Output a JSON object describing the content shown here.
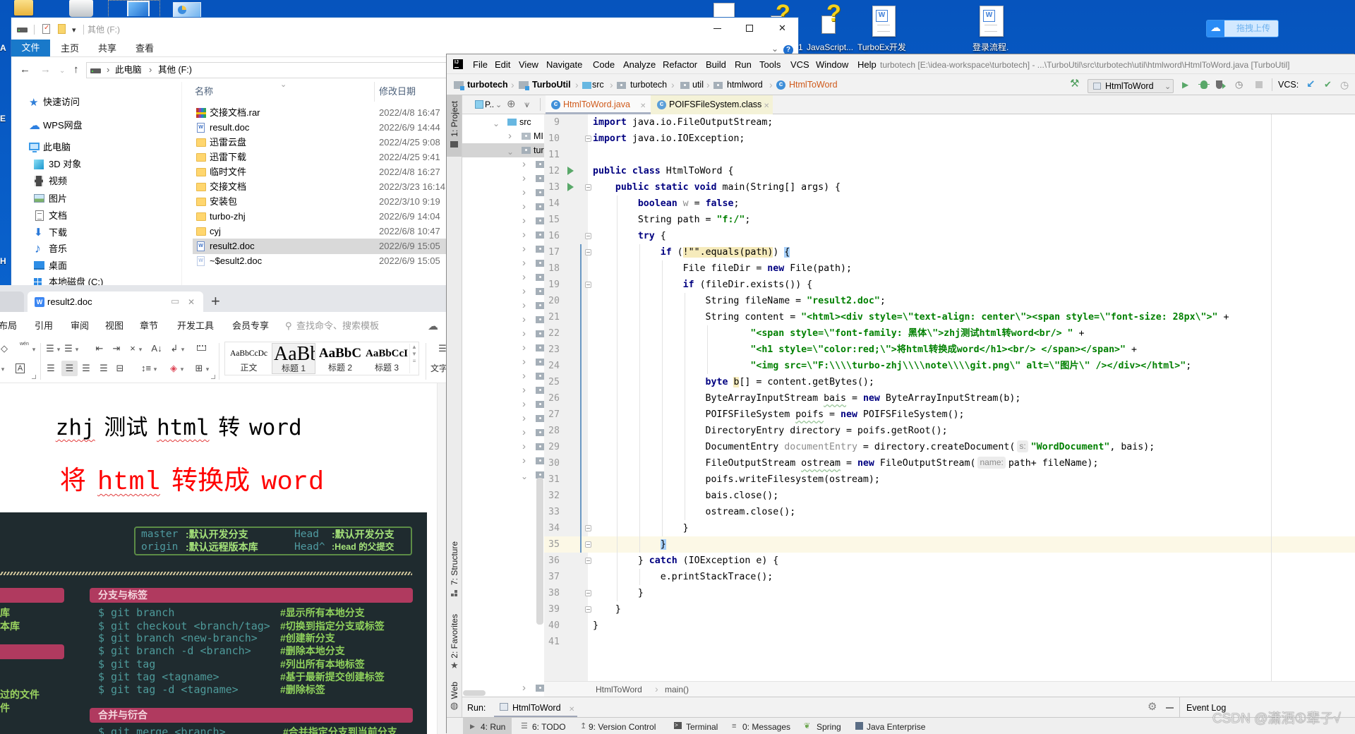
{
  "desktop": {
    "edge_letters": [
      "A",
      "E",
      "H"
    ],
    "icons": [
      {
        "label": "1",
        "icon": "help-file"
      },
      {
        "label": "JavaScript...",
        "icon": "help-file"
      },
      {
        "label": "TurboEx开发",
        "icon": "word-document"
      },
      {
        "label": "登录流程.",
        "icon": "word-document"
      }
    ],
    "upload_widget": {
      "label": "拖拽上传",
      "icon": "baidu-netdisk",
      "color": "#2b8cf5"
    }
  },
  "explorer": {
    "title": "其他 (F:)",
    "ribbon_tabs": [
      "文件",
      "主页",
      "共享",
      "查看"
    ],
    "active_ribbon_tab": "文件",
    "accent": "#1979ca",
    "address": [
      "此电脑",
      "其他 (F:)"
    ],
    "nav": [
      {
        "label": "快速访问",
        "icon": "star"
      },
      {
        "label": "WPS网盘",
        "icon": "cloud"
      },
      {
        "label": "此电脑",
        "icon": "computer"
      },
      {
        "label": "3D 对象",
        "icon": "cube"
      },
      {
        "label": "视频",
        "icon": "video"
      },
      {
        "label": "图片",
        "icon": "picture"
      },
      {
        "label": "文档",
        "icon": "document"
      },
      {
        "label": "下载",
        "icon": "download"
      },
      {
        "label": "音乐",
        "icon": "music"
      },
      {
        "label": "桌面",
        "icon": "desktop"
      },
      {
        "label": "本地磁盘 (C:)",
        "icon": "drive"
      }
    ],
    "columns": {
      "name": "名称",
      "modified": "修改日期"
    },
    "files": [
      {
        "name": "交接文档.rar",
        "modified": "2022/4/8 16:47",
        "type": "rar"
      },
      {
        "name": "result.doc",
        "modified": "2022/6/9 14:44",
        "type": "doc"
      },
      {
        "name": "迅雷云盘",
        "modified": "2022/4/25 9:08",
        "type": "folder"
      },
      {
        "name": "迅雷下载",
        "modified": "2022/4/25 9:41",
        "type": "folder"
      },
      {
        "name": "临时文件",
        "modified": "2022/4/8 16:27",
        "type": "folder"
      },
      {
        "name": "交接文档",
        "modified": "2022/3/23 16:14",
        "type": "folder"
      },
      {
        "name": "安装包",
        "modified": "2022/3/10 9:19",
        "type": "folder"
      },
      {
        "name": "turbo-zhj",
        "modified": "2022/6/9 14:04",
        "type": "folder"
      },
      {
        "name": "cyj",
        "modified": "2022/6/8 10:47",
        "type": "folder"
      },
      {
        "name": "result2.doc",
        "modified": "2022/6/9 15:05",
        "type": "doc",
        "selected": true
      },
      {
        "name": "~$esult2.doc",
        "modified": "2022/6/9 15:05",
        "type": "doc-temp"
      }
    ]
  },
  "wps": {
    "tab": "result2.doc",
    "menu": [
      "布局",
      "引用",
      "审阅",
      "视图",
      "章节",
      "开发工具",
      "会员专享"
    ],
    "search_placeholder": "查找命令、搜索模板",
    "pinyin_hint": "wén",
    "styles": [
      {
        "sample": "AaBbCcDc",
        "label": "正文"
      },
      {
        "sample": "AaBb",
        "label": "标题 1",
        "selected": true
      },
      {
        "sample": "AaBbC",
        "label": "标题 2"
      },
      {
        "sample": "AaBbCcI",
        "label": "标题 3"
      }
    ],
    "text_tool_label": "文字",
    "document": {
      "line1": [
        {
          "text": "zhj",
          "misspelled": true
        },
        {
          "text": " 测试 "
        },
        {
          "text": "html",
          "misspelled": true
        },
        {
          "text": " 转 word"
        }
      ],
      "line2": [
        {
          "text": "将 "
        },
        {
          "text": "html",
          "misspelled": true
        },
        {
          "text": " 转换成 word"
        }
      ],
      "line2_color": "#ff0000",
      "image": {
        "legend": [
          {
            "term": "master",
            "desc": ":默认开发分支"
          },
          {
            "term": "Head",
            "desc": ":默认开发分支"
          },
          {
            "term": "origin",
            "desc": ":默认远程版本库"
          },
          {
            "term": "Head^",
            "desc": ":Head 的父提交"
          }
        ],
        "left_fragments": [
          "库",
          "本库",
          "过的文件",
          "件"
        ],
        "sections": [
          {
            "title": "分支与标签",
            "commands": [
              {
                "cmd": "$ git branch",
                "comment": "#显示所有本地分支"
              },
              {
                "cmd": "$ git checkout <branch/tag>",
                "comment": "#切换到指定分支或标签"
              },
              {
                "cmd": "$ git branch <new-branch>",
                "comment": "#创建新分支"
              },
              {
                "cmd": "$ git branch -d <branch>",
                "comment": "#删除本地分支"
              },
              {
                "cmd": "$ git tag",
                "comment": "#列出所有本地标签"
              },
              {
                "cmd": "$ git tag <tagname>",
                "comment": "#基于最新提交创建标签"
              },
              {
                "cmd": "$ git tag -d <tagname>",
                "comment": "#删除标签"
              }
            ]
          },
          {
            "title": "合并与衍合",
            "commands": [
              {
                "cmd": "$ git merge <branch>",
                "comment": "#合并指定分支到当前分支"
              }
            ]
          }
        ],
        "colors": {
          "background": "#1f2b2f",
          "section_bar": "#b03a5f",
          "command": "#4e9a9a",
          "comment": "#8fd15c",
          "legend_border": "#5c8c46"
        }
      }
    }
  },
  "ide": {
    "menu": [
      "File",
      "Edit",
      "View",
      "Navigate",
      "Code",
      "Analyze",
      "Refactor",
      "Build",
      "Run",
      "Tools",
      "VCS",
      "Window",
      "Help"
    ],
    "title": "turbotech [E:\\idea-workspace\\turbotech] - ...\\TurboUtil\\src\\turbotech\\util\\htmlword\\HtmlToWord.java [TurboUtil]",
    "navbar": [
      "turbotech",
      "TurboUtil",
      "src",
      "turbotech",
      "util",
      "htmlword",
      "HtmlToWord"
    ],
    "run_config": "HtmlToWord",
    "vcs_label": "VCS:",
    "tool_stripe": [
      "1: Project",
      "7: Structure",
      "2: Favorites",
      "Web"
    ],
    "project": {
      "view_label": "P..",
      "tree": [
        {
          "label": "src",
          "expanded": true
        },
        {
          "label": "MI",
          "expanded": false
        },
        {
          "label": "tur",
          "expanded": true,
          "selected": true
        }
      ],
      "collapsed_child_rows": 22
    },
    "tabs": [
      {
        "label": "HtmlToWord.java",
        "active": true
      },
      {
        "label": "POIFSFileSystem.class",
        "active": false
      }
    ],
    "editor": {
      "first_line": 9,
      "current_line": 35,
      "run_lines": [
        12,
        13
      ],
      "fold_lines": [
        10,
        13,
        16,
        17,
        19,
        34,
        35,
        36,
        38,
        39
      ],
      "changed_lines": [
        17,
        35
      ],
      "lines": [
        [
          [
            "kw",
            "import"
          ],
          [
            "",
            " java.io.FileOutputStream;"
          ]
        ],
        [
          [
            "kw",
            "import"
          ],
          [
            "",
            " java.io.IOException;"
          ]
        ],
        [],
        [
          [
            "kw",
            "public class"
          ],
          [
            "",
            " HtmlToWord {"
          ]
        ],
        [
          [
            "",
            "    "
          ],
          [
            "kw",
            "public static void"
          ],
          [
            "",
            " main(String[] args) {"
          ]
        ],
        [
          [
            "",
            "        "
          ],
          [
            "kw",
            "boolean"
          ],
          [
            "",
            " "
          ],
          [
            "unused",
            "w"
          ],
          [
            "",
            " = "
          ],
          [
            "kw",
            "false"
          ],
          [
            "",
            ";"
          ]
        ],
        [
          [
            "",
            "        String path = "
          ],
          [
            "str",
            "\"f:/\""
          ],
          [
            "",
            ";"
          ]
        ],
        [
          [
            "",
            "        "
          ],
          [
            "kw",
            "try"
          ],
          [
            "",
            " {"
          ]
        ],
        [
          [
            "",
            "            "
          ],
          [
            "kw",
            "if"
          ],
          [
            "",
            " ("
          ],
          [
            "hl",
            "!\"\".equals(path)"
          ],
          [
            "",
            ") "
          ],
          [
            "brace",
            "{"
          ]
        ],
        [
          [
            "",
            "                File fileDir = "
          ],
          [
            "kw",
            "new"
          ],
          [
            "",
            " File(path);"
          ]
        ],
        [
          [
            "",
            "                "
          ],
          [
            "kw",
            "if"
          ],
          [
            "",
            " (fileDir.exists()) {"
          ]
        ],
        [
          [
            "",
            "                    String fileName = "
          ],
          [
            "str",
            "\"result2.doc\""
          ],
          [
            "",
            ";"
          ]
        ],
        [
          [
            "",
            "                    String content = "
          ],
          [
            "str",
            "\"<html><div style=\\\"text-align: center\\\"><span style=\\\"font-size: 28px\\\">\""
          ],
          [
            "",
            " +"
          ]
        ],
        [
          [
            "",
            "                            "
          ],
          [
            "str",
            "\"<span style=\\\"font-family: 黑体\\\">zhj测试html转word<br/> \""
          ],
          [
            "",
            " +"
          ]
        ],
        [
          [
            "",
            "                            "
          ],
          [
            "str",
            "\"<h1 style=\\\"color:red;\\\">将html转换成word</h1><br/> </span></span>\""
          ],
          [
            "",
            " +"
          ]
        ],
        [
          [
            "",
            "                            "
          ],
          [
            "str",
            "\"<img src=\\\"F:\\\\\\\\turbo-zhj\\\\\\\\note\\\\\\\\git.png\\\" alt=\\\"图片\\\" /></div></html>\""
          ],
          [
            "",
            ";"
          ]
        ],
        [
          [
            "",
            "                    "
          ],
          [
            "kw",
            "byte"
          ],
          [
            "",
            " "
          ],
          [
            "hlvar",
            "b"
          ],
          [
            "",
            "[] = content.getBytes();"
          ]
        ],
        [
          [
            "",
            "                    ByteArrayInputStream "
          ],
          [
            "wavy",
            "bais"
          ],
          [
            "",
            " = "
          ],
          [
            "kw",
            "new"
          ],
          [
            "",
            " ByteArrayInputStream(b);"
          ]
        ],
        [
          [
            "",
            "                    POIFSFileSystem "
          ],
          [
            "wavy",
            "poifs"
          ],
          [
            "",
            " = "
          ],
          [
            "kw",
            "new"
          ],
          [
            "",
            " POIFSFileSystem();"
          ]
        ],
        [
          [
            "",
            "                    DirectoryEntry directory = poifs.getRoot();"
          ]
        ],
        [
          [
            "",
            "                    DocumentEntry "
          ],
          [
            "unused",
            "documentEntry"
          ],
          [
            "",
            " = directory.createDocument("
          ],
          [
            "hint",
            "s:"
          ],
          [
            "str",
            "\"WordDocument\""
          ],
          [
            "",
            ", bais);"
          ]
        ],
        [
          [
            "",
            "                    FileOutputStream "
          ],
          [
            "wavy",
            "ostream"
          ],
          [
            "",
            " = "
          ],
          [
            "kw",
            "new"
          ],
          [
            "",
            " FileOutputStream("
          ],
          [
            "hint",
            "name:"
          ],
          [
            "",
            "path+ fileName);"
          ]
        ],
        [
          [
            "",
            "                    poifs.writeFilesystem(ostream);"
          ]
        ],
        [
          [
            "",
            "                    bais.close();"
          ]
        ],
        [
          [
            "",
            "                    ostream.close();"
          ]
        ],
        [
          [
            "",
            "                }"
          ]
        ],
        [
          [
            "",
            "            "
          ],
          [
            "brace",
            "}"
          ]
        ],
        [
          [
            "",
            "        } "
          ],
          [
            "kw",
            "catch"
          ],
          [
            "",
            " (IOException e) {"
          ]
        ],
        [
          [
            "",
            "            e.printStackTrace();"
          ]
        ],
        [
          [
            "",
            "        }"
          ]
        ],
        [
          [
            "",
            "    }"
          ]
        ],
        [
          [
            "",
            "}"
          ]
        ],
        []
      ]
    },
    "breadcrumb": [
      "HtmlToWord",
      "main()"
    ],
    "run_panel": {
      "label": "Run:",
      "tab": "HtmlToWord"
    },
    "event_log": "Event Log",
    "bottom_tools": [
      {
        "label": "4: Run",
        "icon": "run",
        "active": true
      },
      {
        "label": "6: TODO",
        "icon": "todo"
      },
      {
        "label": "9: Version Control",
        "icon": "version-control"
      },
      {
        "label": "Terminal",
        "icon": "terminal"
      },
      {
        "label": "0: Messages",
        "icon": "messages"
      },
      {
        "label": "Spring",
        "icon": "spring"
      },
      {
        "label": "Java Enterprise",
        "icon": "java-enterprise"
      }
    ],
    "colors": {
      "keyword": "#000080",
      "string": "#008000",
      "error_file": "#cf5a1b",
      "current_line": "#fcf8e6"
    }
  },
  "watermark": "CSDN @潇洒①辈子√"
}
